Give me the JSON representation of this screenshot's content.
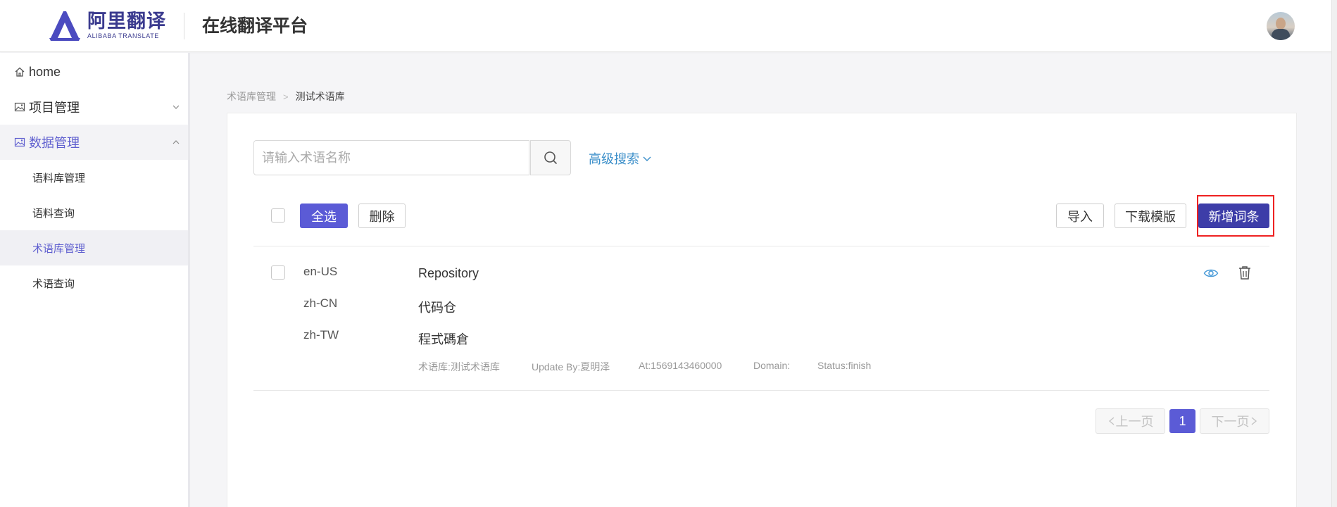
{
  "header": {
    "logo_cn": "阿里翻译",
    "logo_en": "ALIBABA TRANSLATE",
    "platform_title": "在线翻译平台"
  },
  "sidebar": {
    "items": [
      {
        "label": "home",
        "icon": "home-icon"
      },
      {
        "label": "项目管理",
        "icon": "image-icon",
        "expanded": false
      },
      {
        "label": "数据管理",
        "icon": "image-icon",
        "expanded": true
      }
    ],
    "sub_items": [
      {
        "label": "语料库管理"
      },
      {
        "label": "语料查询"
      },
      {
        "label": "术语库管理",
        "selected": true
      },
      {
        "label": "术语查询"
      }
    ]
  },
  "breadcrumb": {
    "parent": "术语库管理",
    "separator": ">",
    "current": "测试术语库"
  },
  "search": {
    "placeholder": "请输入术语名称",
    "value": "",
    "advanced_label": "高级搜索"
  },
  "toolbar": {
    "select_all_label": "全选",
    "delete_label": "删除",
    "import_label": "导入",
    "download_template_label": "下载模版",
    "add_entry_label": "新增词条"
  },
  "entries": [
    {
      "translations": [
        {
          "lang": "en-US",
          "text": "Repository"
        },
        {
          "lang": "zh-CN",
          "text": "代码仓"
        },
        {
          "lang": "zh-TW",
          "text": "程式碼倉"
        }
      ],
      "meta": {
        "termbase": "术语库:测试术语库",
        "update_by": "Update By:夏明泽",
        "at": "At:1569143460000",
        "domain": "Domain:",
        "status": "Status:finish"
      }
    }
  ],
  "pagination": {
    "prev_label": "上一页",
    "current_page": "1",
    "next_label": "下一页"
  },
  "colors": {
    "primary": "#5b5bd6",
    "dark_primary": "#3d3da8",
    "link": "#3a8ec9",
    "highlight": "#ee2222"
  }
}
